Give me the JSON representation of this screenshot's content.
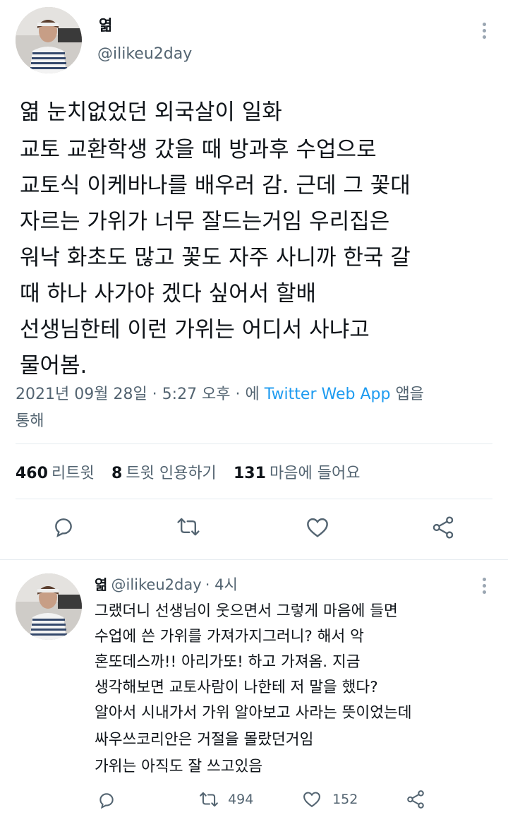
{
  "tweet": {
    "author_name": "엶",
    "author_handle": "@ilikeu2day",
    "body_lines": [
      "엶 눈치없었던 외국살이 일화",
      "교토 교환학생 갔을 때 방과후 수업으로",
      "교토식 이케바나를 배우러 감. 근데 그 꽃대",
      "자르는 가위가 너무 잘드는거임 우리집은",
      "워낙 화초도 많고 꽃도 자주 사니까 한국 갈",
      "때 하나 사가야 겠다 싶어서 할배",
      "선생님한테 이런 가위는 어디서 사냐고",
      "물어봄."
    ],
    "meta": {
      "timestamp": "2021년 09월 28일 · 5:27 오후 · 에",
      "source": "Twitter Web App",
      "suffix": "앱을",
      "suffix2": "통해"
    },
    "stats": {
      "retweets_count": "460",
      "retweets_label": "리트윗",
      "quotes_count": "8",
      "quotes_label": "트윗 인용하기",
      "likes_count": "131",
      "likes_label": "마음에 들어요"
    },
    "actions": [
      "reply-icon",
      "retweet-icon",
      "like-icon",
      "share-icon"
    ]
  },
  "reply": {
    "author_name": "엶",
    "author_handle": "@ilikeu2day",
    "time": "· 4시",
    "body_lines": [
      "그랬더니 선생님이 웃으면서 그렇게 마음에 들면",
      "수업에 쓴 가위를 가져가지그러니? 해서 악",
      "혼또데스까!! 아리가또! 하고 가져옴. 지금",
      "생각해보면 교토사람이 나한테 저 말을 했다?",
      "알아서 시내가서 가위 알아보고 사라는 뜻이었는데",
      "싸우쓰코리안은 거절을 몰랐던거임",
      "가위는 아직도 잘 쓰고있음"
    ],
    "retweet_count": "494",
    "like_count": "152"
  },
  "colors": {
    "text": "#0f1419",
    "secondary": "#536471",
    "link": "#1d9bf0",
    "divider": "#e6ecf0"
  }
}
